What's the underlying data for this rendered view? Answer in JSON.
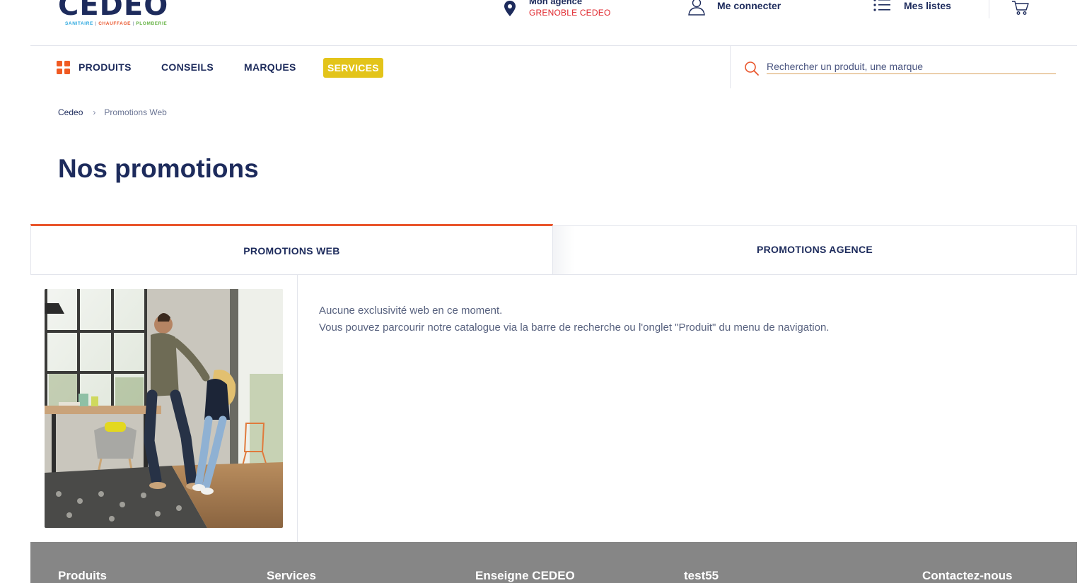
{
  "header": {
    "logo": {
      "word": "CEDEO",
      "tagline": [
        "SANITAIRE",
        "CHAUFFAGE",
        "PLOMBERIE"
      ],
      "tagline_colors": [
        "#2aa7df",
        "#e9552b",
        "#67b346"
      ]
    },
    "agency": {
      "label": "Mon agence",
      "value": "GRENOBLE CEDEO",
      "icon": "location-pin-icon"
    },
    "account": {
      "label": "Me connecter",
      "icon": "user-icon"
    },
    "lists": {
      "label": "Mes listes",
      "icon": "list-icon"
    },
    "cart": {
      "icon": "cart-icon"
    }
  },
  "nav": {
    "items": [
      {
        "label": "PRODUITS",
        "icon": "grid-icon"
      },
      {
        "label": "CONSEILS"
      },
      {
        "label": "MARQUES"
      },
      {
        "label": "SERVICES"
      }
    ],
    "search": {
      "placeholder": "Rechercher un produit, une marque",
      "icon": "search-icon"
    }
  },
  "breadcrumb": {
    "home": "Cedeo",
    "separator": "›",
    "current": "Promotions Web"
  },
  "page": {
    "title": "Nos promotions"
  },
  "tabs": [
    {
      "label": "PROMOTIONS WEB",
      "active": true
    },
    {
      "label": "PROMOTIONS AGENCE",
      "active": false
    }
  ],
  "content": {
    "message_line1": "Aucune exclusivité web en ce moment.",
    "message_line2": "Vous pouvez parcourir notre catalogue via la barre de recherche ou l'onglet \"Produit\" du menu de navigation."
  },
  "footer": {
    "columns": [
      "Produits",
      "Services",
      "Enseigne CEDEO",
      "test55",
      "Contactez-nous"
    ]
  },
  "colors": {
    "brand_navy": "#1d2b5c",
    "accent_orange": "#e9552b",
    "services_yellow": "#e3c41a",
    "agency_red": "#e0262c",
    "footer_gray": "#868686"
  }
}
